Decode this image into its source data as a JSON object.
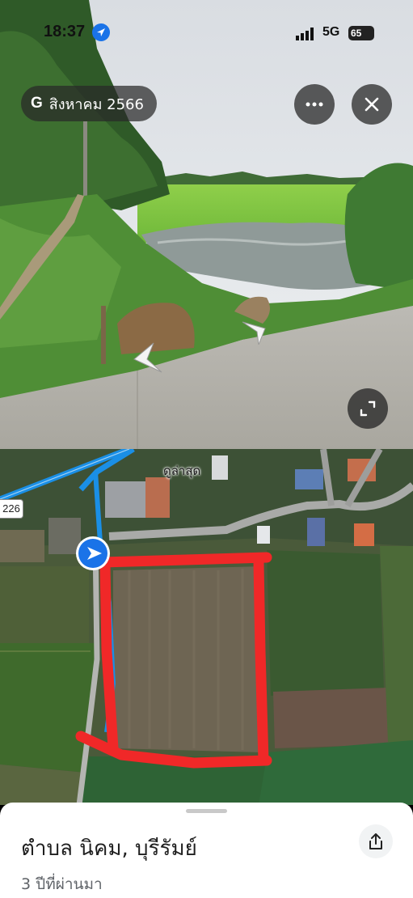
{
  "status_bar": {
    "time": "18:37",
    "network": "5G",
    "battery": "65"
  },
  "street_view": {
    "date_brand": "G",
    "date_label": "สิงหาคม 2566"
  },
  "map": {
    "place_label": "ดูล่าสุด",
    "road_number": "226"
  },
  "place_sheet": {
    "title": "ตำบล นิคม, บุรีรัมย์",
    "subtitle": "3 ปีที่ผ่านมา"
  },
  "colors": {
    "route_blue": "#1a8fe6",
    "annotation_red": "#f02828",
    "location_blue": "#1a73e8"
  },
  "icons": [
    "location-arrow-icon",
    "signal-icon",
    "more-icon",
    "close-icon",
    "expand-icon",
    "chevron-left-icon",
    "chevron-right-icon",
    "navigation-arrow-icon",
    "share-icon"
  ]
}
